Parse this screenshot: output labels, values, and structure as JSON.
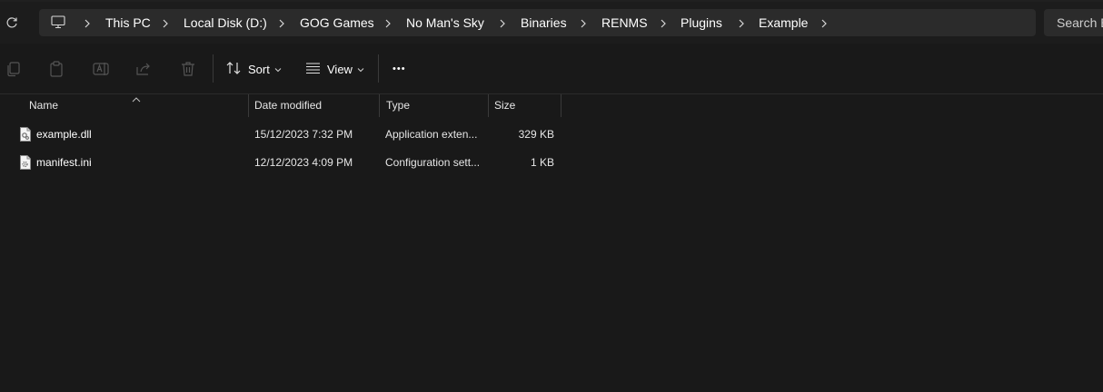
{
  "breadcrumb": {
    "items": [
      "This PC",
      "Local Disk (D:)",
      "GOG Games",
      "No Man's Sky",
      "Binaries",
      "RENMS",
      "Plugins",
      "Example"
    ]
  },
  "search": {
    "placeholder": "Search E"
  },
  "toolbar": {
    "sort_label": "Sort",
    "view_label": "View",
    "more_label": "•••"
  },
  "columns": {
    "name": "Name",
    "date": "Date modified",
    "type": "Type",
    "size": "Size"
  },
  "files": [
    {
      "name": "example.dll",
      "date": "15/12/2023 7:32 PM",
      "type": "Application exten...",
      "size": "329 KB",
      "icon": "dll-file-icon"
    },
    {
      "name": "manifest.ini",
      "date": "12/12/2023 4:09 PM",
      "type": "Configuration sett...",
      "size": "1 KB",
      "icon": "ini-file-icon"
    }
  ],
  "colors": {
    "background": "#191919",
    "addressbar": "#2b2b2b",
    "text": "#ffffff"
  }
}
